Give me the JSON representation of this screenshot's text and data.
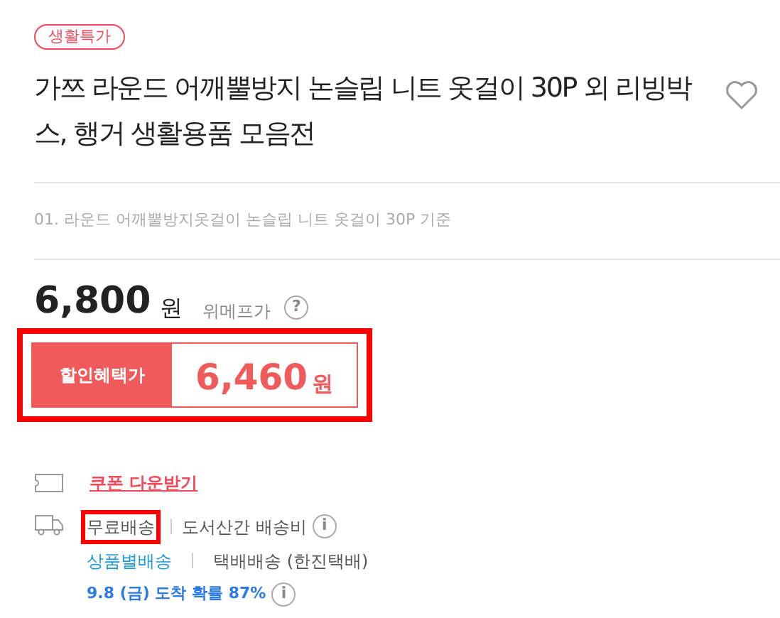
{
  "badge": "생활특가",
  "title": "가쯔 라운드 어깨뿔방지 논슬립 니트 옷걸이 30P 외 리빙박스, 행거 생활용품 모음전",
  "wishlisted": false,
  "option": "01. 라운드 어깨뿔방지옷걸이 논슬립 니트 옷걸이 30P 기준",
  "price": {
    "amount": "6,800",
    "unit": "원",
    "label": "위메프가",
    "help": "?"
  },
  "discount": {
    "label": "할인혜택가",
    "amount": "6,460",
    "unit": "원",
    "highlighted": true
  },
  "coupon": {
    "link": "쿠폰 다운받기"
  },
  "shipping": {
    "fee": "무료배송",
    "fee_highlighted": true,
    "note": "도서산간 배송비",
    "info": "i",
    "method": "상품별배송",
    "carrier": "택배배송 (한진택배)",
    "eta": "9.8 (금) 도착 확률 87%",
    "eta_info": "i"
  }
}
